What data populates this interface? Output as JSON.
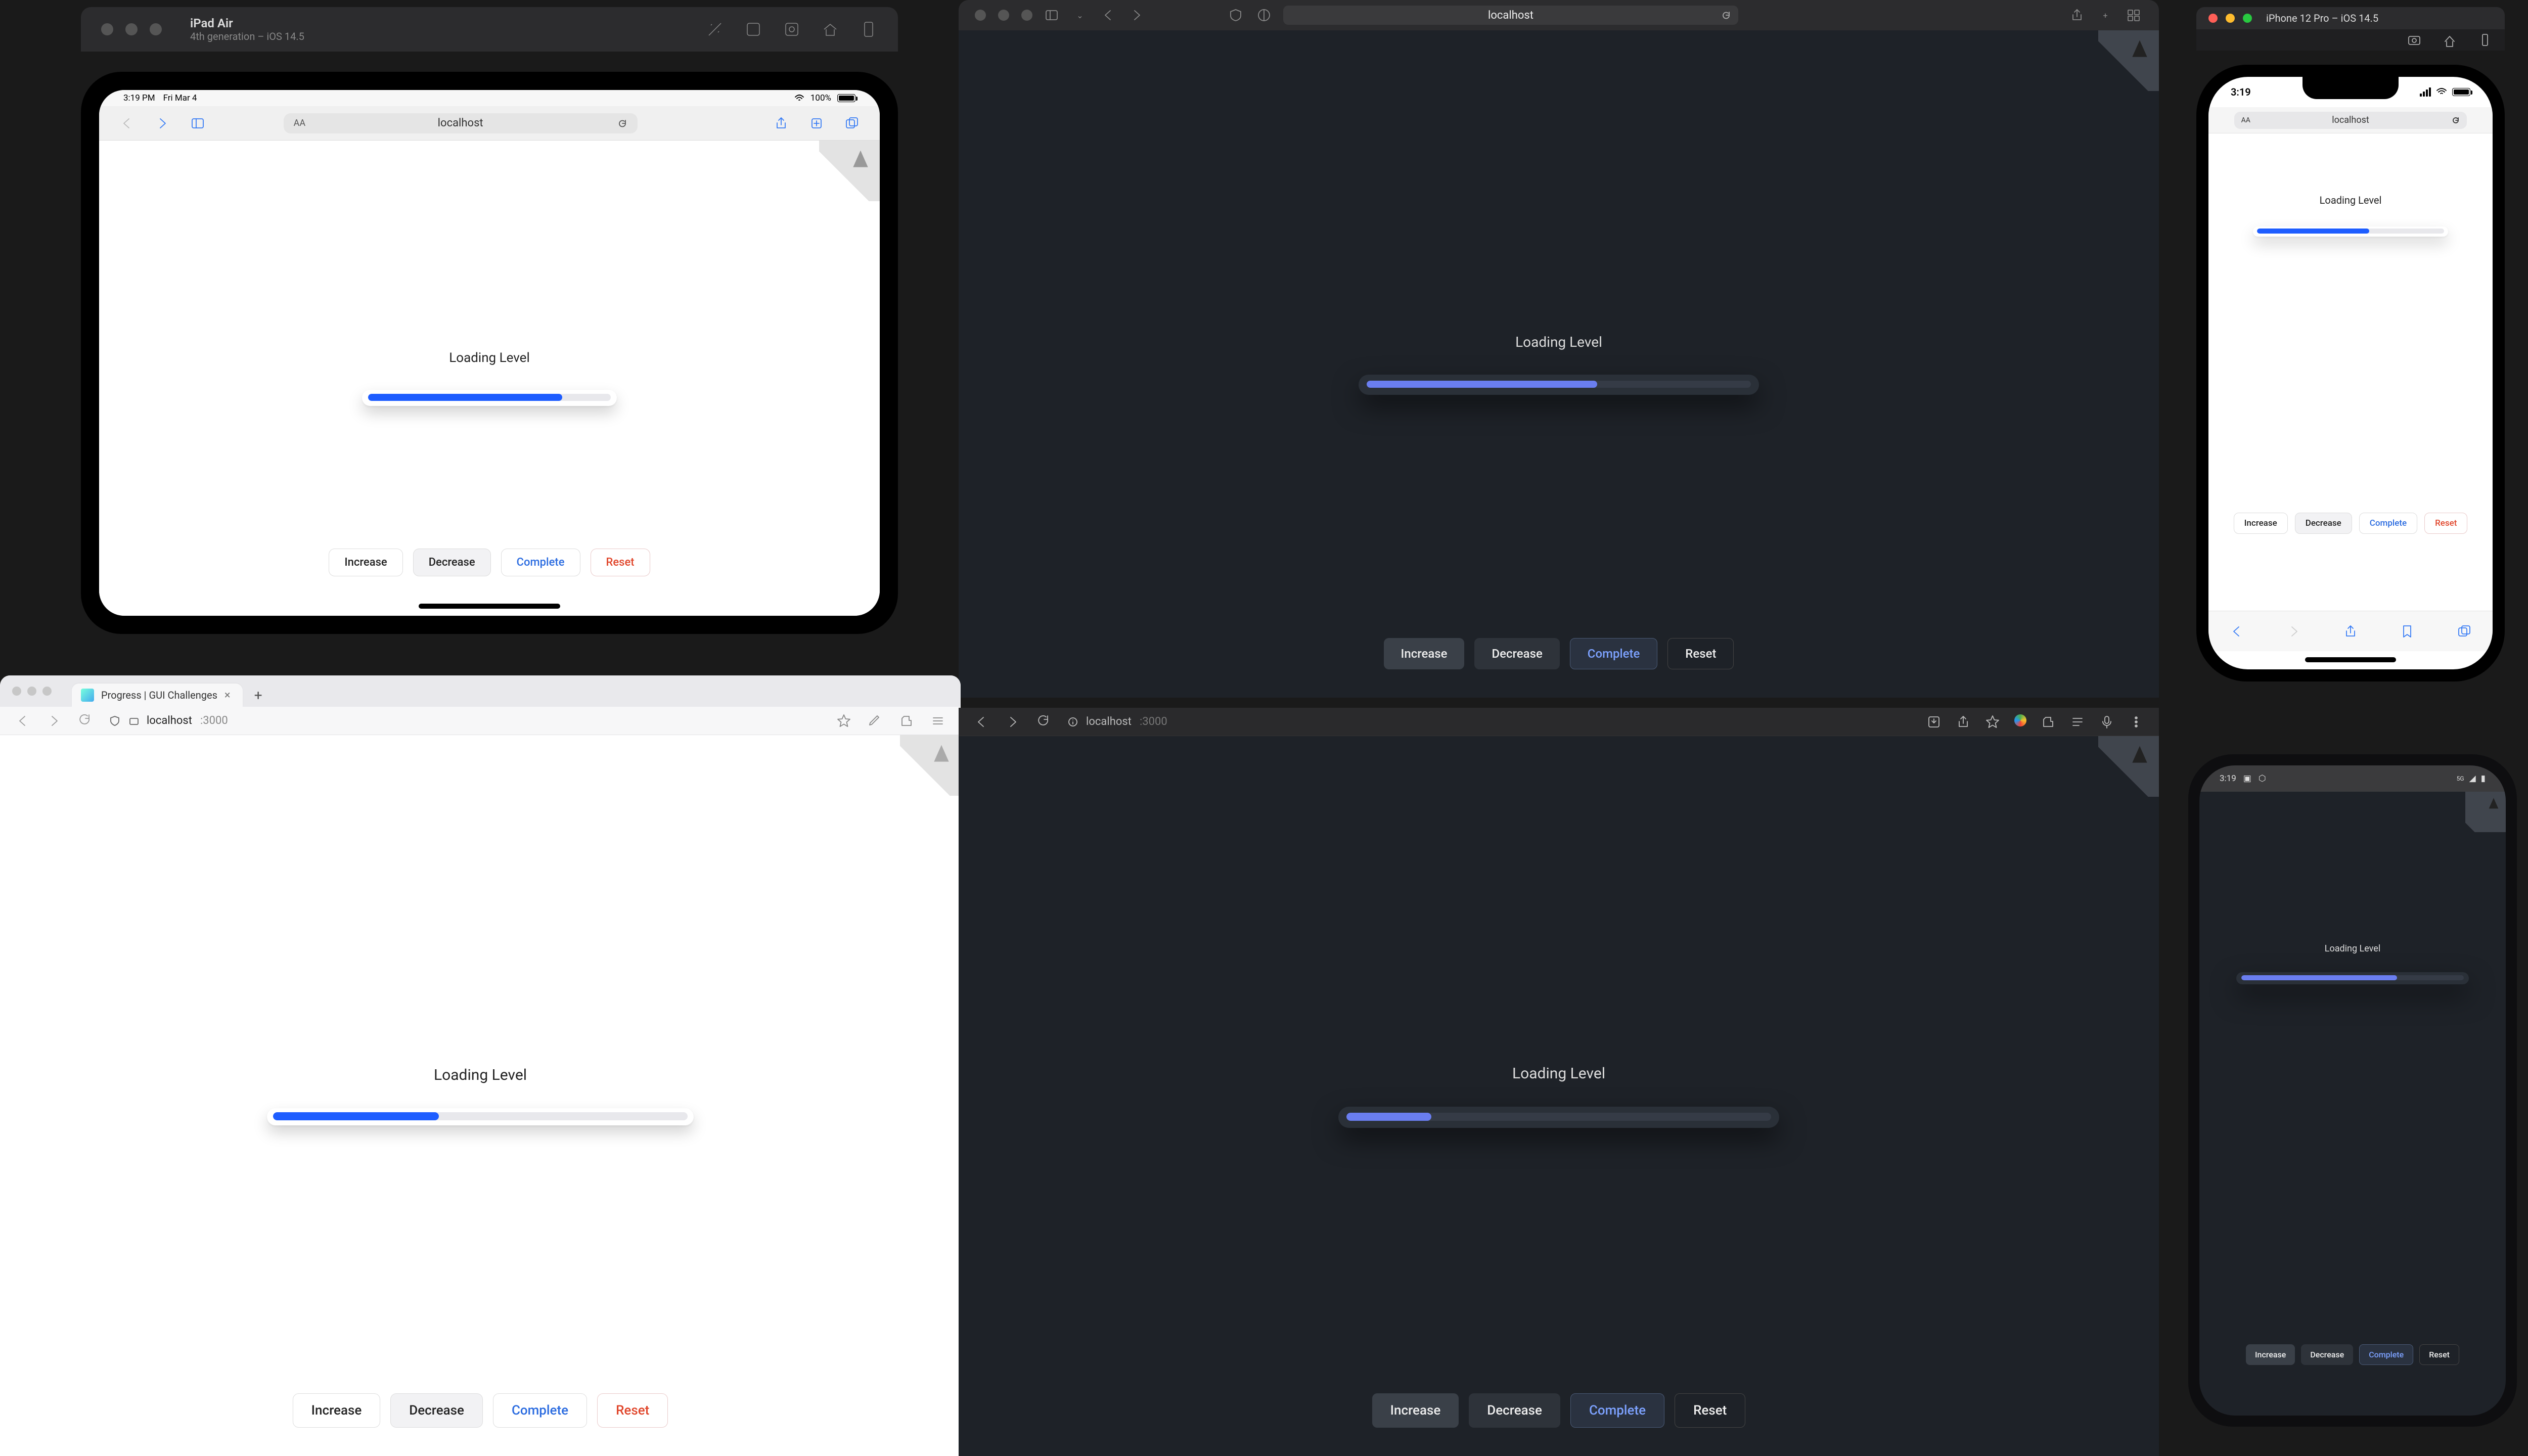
{
  "app": {
    "loading_label": "Loading Level",
    "buttons": {
      "increase": "Increase",
      "decrease": "Decrease",
      "complete": "Complete",
      "reset": "Reset"
    }
  },
  "pane1_ipad": {
    "window_title": "iPad Air",
    "window_subtitle": "4th generation – iOS 14.5",
    "status_time": "3:19 PM",
    "status_date": "Fri Mar 4",
    "battery_label": "100%",
    "url_text": "localhost",
    "progress_percent": 80
  },
  "pane2_safari_dark": {
    "url_text": "localhost",
    "progress_percent": 60
  },
  "pane3_iphone": {
    "window_title": "iPhone 12 Pro – iOS 14.5",
    "status_time": "3:19",
    "url_text": "localhost",
    "progress_percent": 60
  },
  "pane4_browser_light": {
    "tab_title": "Progress | GUI Challenges",
    "url_host": "localhost",
    "url_port": ":3000",
    "progress_percent": 40
  },
  "pane5_browser_dark": {
    "url_host": "localhost",
    "url_port": ":3000",
    "progress_percent": 20
  },
  "pane6_android": {
    "status_time": "3:19",
    "status_icons": "5G",
    "progress_percent": 70
  },
  "colors": {
    "accent_light": "#1e5dff",
    "accent_dark": "#6a7ef0",
    "complete_light": "#2a6be0",
    "reset_light": "#e0452a"
  }
}
